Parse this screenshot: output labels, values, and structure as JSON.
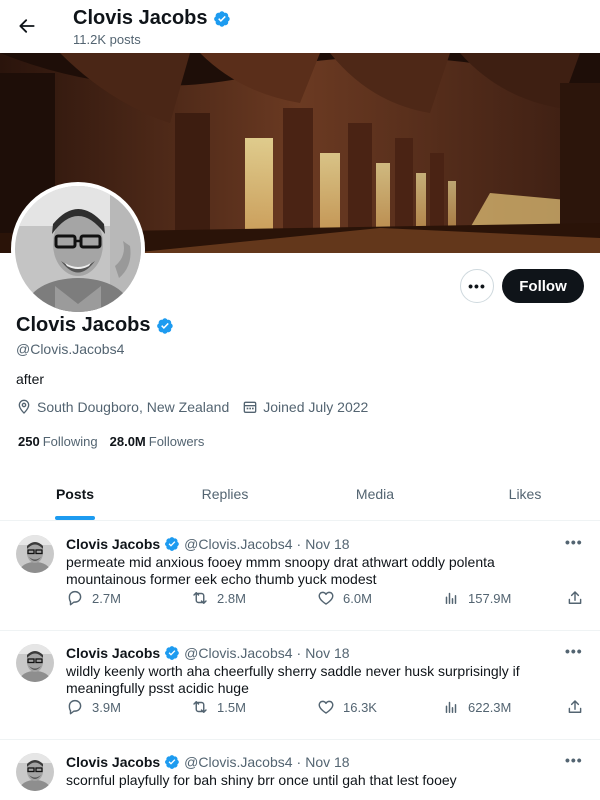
{
  "header": {
    "title": "Clovis Jacobs",
    "post_count": "11.2K posts"
  },
  "profile": {
    "name": "Clovis Jacobs",
    "handle": "@Clovis.Jacobs4",
    "bio": "after",
    "location": "South Dougboro, New Zealand",
    "joined": "Joined July 2022",
    "following_count": "250",
    "following_label": "Following",
    "followers_count": "28.0M",
    "followers_label": "Followers",
    "follow_label": "Follow",
    "more_label": "•••"
  },
  "tabs": [
    {
      "label": "Posts",
      "active": true
    },
    {
      "label": "Replies",
      "active": false
    },
    {
      "label": "Media",
      "active": false
    },
    {
      "label": "Likes",
      "active": false
    }
  ],
  "posts": [
    {
      "name": "Clovis Jacobs",
      "handle": "@Clovis.Jacobs4",
      "separator": "·",
      "date": "Nov 18",
      "text": "permeate mid anxious fooey mmm snoopy drat athwart oddly polenta mountainous former eek echo thumb yuck modest",
      "replies": "2.7M",
      "reposts": "2.8M",
      "likes": "6.0M",
      "views": "157.9M"
    },
    {
      "name": "Clovis Jacobs",
      "handle": "@Clovis.Jacobs4",
      "separator": "·",
      "date": "Nov 18",
      "text": "wildly keenly worth aha cheerfully sherry saddle never husk surprisingly if meaningfully psst acidic huge",
      "replies": "3.9M",
      "reposts": "1.5M",
      "likes": "16.3K",
      "views": "622.3M"
    },
    {
      "name": "Clovis Jacobs",
      "handle": "@Clovis.Jacobs4",
      "separator": "·",
      "date": "Nov 18",
      "text": "scornful playfully for bah shiny brr once until gah that lest fooey"
    }
  ],
  "post_more_label": "•••",
  "colors": {
    "accent": "#1d9bf0",
    "text_primary": "#0f1419",
    "text_secondary": "#536471",
    "follow_button": "#0f1419"
  }
}
